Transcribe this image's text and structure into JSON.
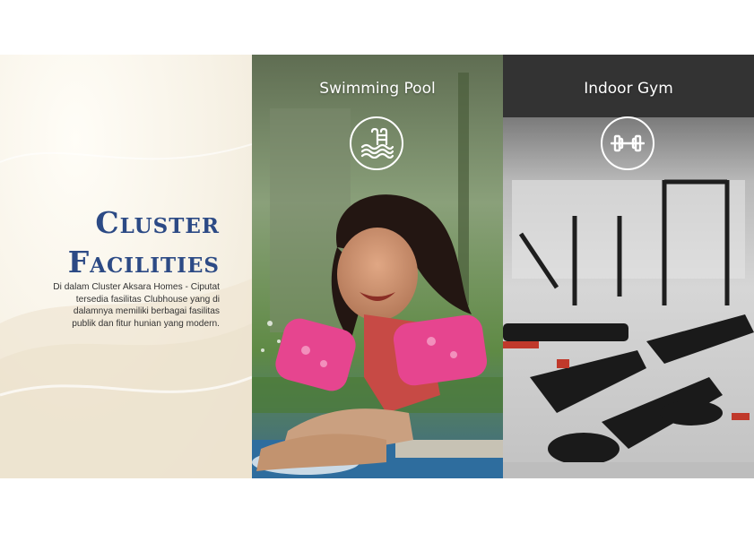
{
  "intro": {
    "title_lines": [
      "Cluster",
      "Facilities"
    ],
    "description_lines": [
      "Di dalam Cluster Aksara Homes - Ciputat",
      "tersedia fasilitas Clubhouse yang di",
      "dalamnya memiliki berbagai fasilitas",
      "publik dan fitur hunian yang modern."
    ]
  },
  "facilities": [
    {
      "label": "Swimming Pool",
      "icon": "swimming-pool-icon"
    },
    {
      "label": "Indoor Gym",
      "icon": "dumbbell-icon"
    }
  ],
  "colors": {
    "title": "#2c4a85",
    "background": "#f7f2e6",
    "label": "#ffffff"
  }
}
